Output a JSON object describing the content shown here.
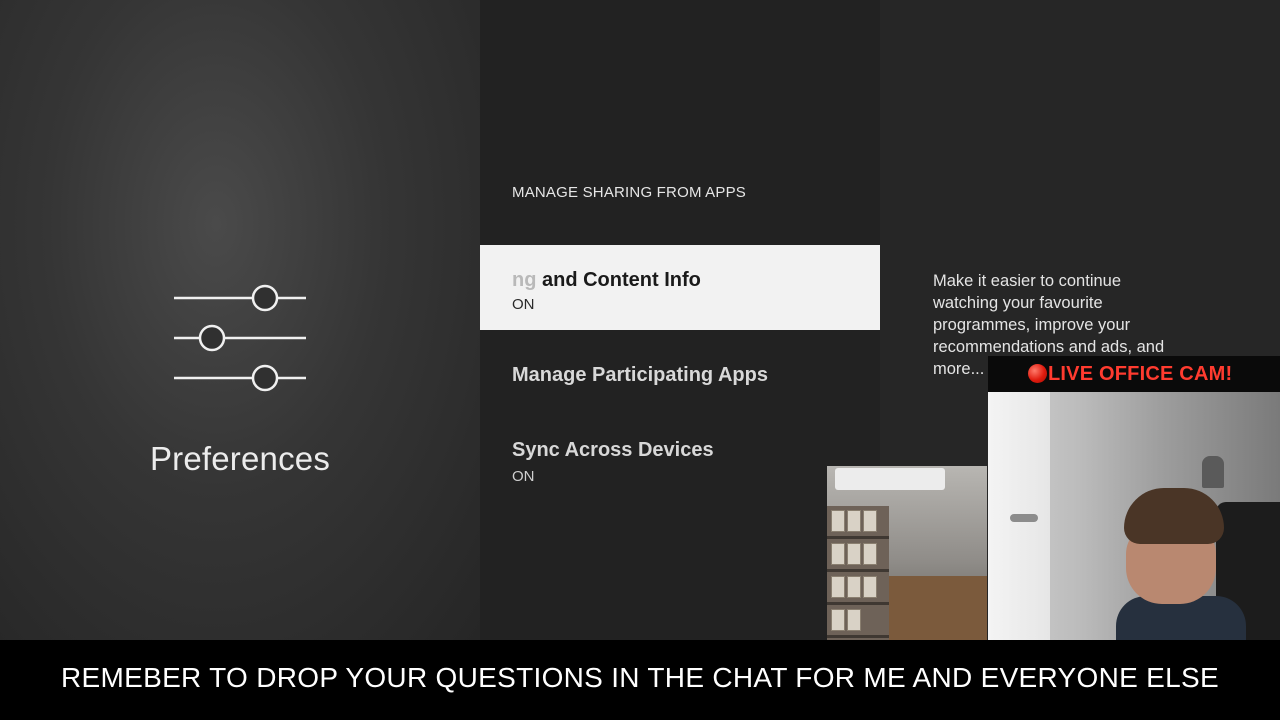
{
  "category": {
    "title": "Preferences",
    "icon": "sliders-icon"
  },
  "section": {
    "header": "MANAGE SHARING FROM APPS"
  },
  "menu": {
    "items": [
      {
        "label_faded": "ng",
        "label": " and Content Info",
        "value": "ON",
        "focused": true
      },
      {
        "label": "Manage Participating Apps",
        "value": "",
        "focused": false
      },
      {
        "label": "Sync Across Devices",
        "value": "ON",
        "focused": false
      }
    ]
  },
  "description": {
    "text": "Make it easier to continue watching your favourite programmes, improve your recommendations and ads, and more..."
  },
  "overlay": {
    "live_label": "LIVE OFFICE CAM!",
    "live_dot_color": "#e01b0e",
    "ticker": "REMEBER TO DROP YOUR QUESTIONS IN THE CHAT FOR ME AND EVERYONE ELSE"
  }
}
